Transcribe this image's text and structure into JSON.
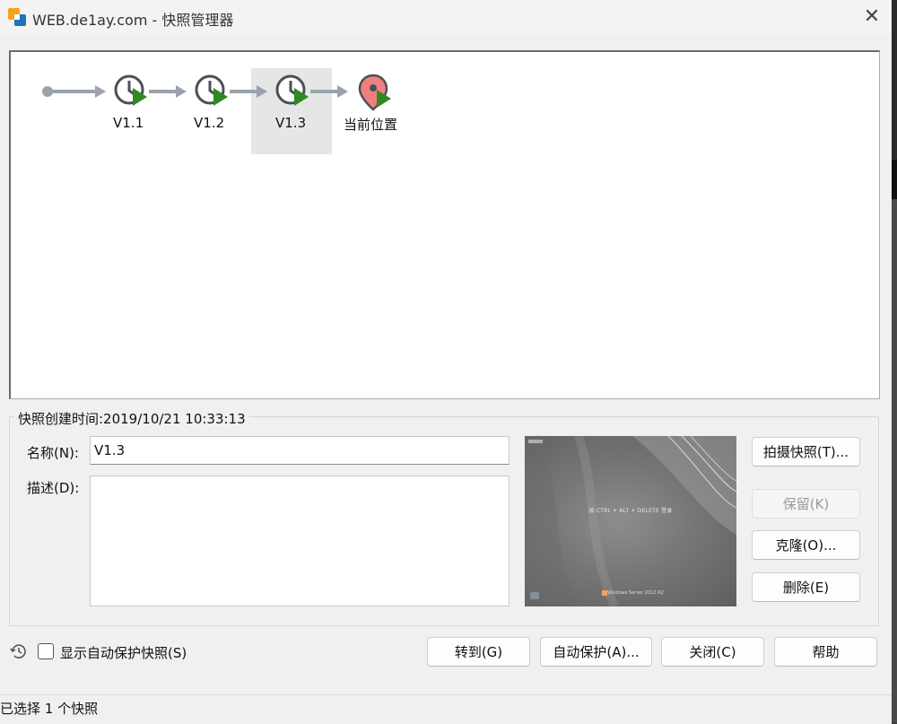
{
  "window": {
    "title": "WEB.de1ay.com - 快照管理器",
    "close_glyph": "✕"
  },
  "tree": {
    "nodes": [
      {
        "label": "V1.1",
        "icon": "snapshot-clock-icon"
      },
      {
        "label": "V1.2",
        "icon": "snapshot-clock-icon"
      },
      {
        "label": "V1.3",
        "icon": "snapshot-clock-icon",
        "selected": true
      },
      {
        "label": "当前位置",
        "icon": "current-location-pin-icon"
      }
    ],
    "colors": {
      "connector": "#9aa3ab",
      "play_badge": "#2f8a1f",
      "pin": "#f08080"
    }
  },
  "details": {
    "group_title": "快照创建时间:2019/10/21 10:33:13",
    "name_label": "名称(N):",
    "name_value": "V1.3",
    "desc_label": "描述(D):",
    "desc_value": ""
  },
  "thumbnail": {
    "screen_text": "按 CTRL + ALT + DELETE 登录",
    "logo_text": "Windows Server 2012 R2"
  },
  "side_buttons": {
    "take_snapshot": "拍摄快照(T)...",
    "keep": "保留(K)",
    "clone": "克隆(O)...",
    "delete": "删除(E)"
  },
  "bottom": {
    "show_autoprotect": "显示自动保护快照(S)",
    "show_autoprotect_checked": false,
    "goto": "转到(G)",
    "autoprotect": "自动保护(A)...",
    "close": "关闭(C)",
    "help": "帮助"
  },
  "status": {
    "text": "已选择 1 个快照"
  }
}
